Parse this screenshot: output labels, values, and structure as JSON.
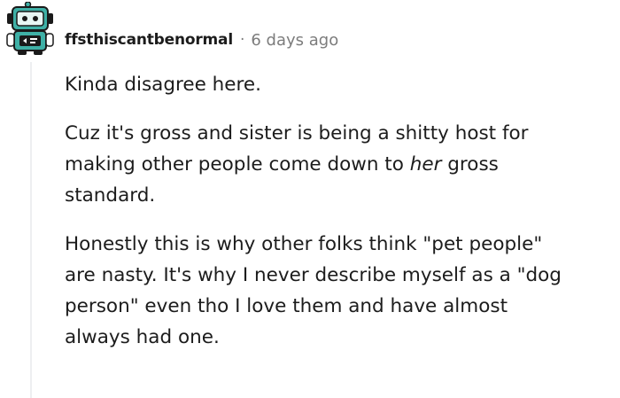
{
  "comment": {
    "author": "ffsthiscantbenormal",
    "separator": "·",
    "timestamp": "6 days ago",
    "avatar_icon": "robot-avatar-icon",
    "paragraphs": [
      {
        "lines": [
          "Kinda disagree here."
        ]
      },
      {
        "line1": "Cuz it's gross and sister is being a shitty host for",
        "line2_before": "making other people come down to ",
        "line2_emphasis": "her",
        "line2_after": " gross",
        "line3": "standard."
      },
      {
        "lines": [
          "Honestly this is why other folks think \"pet people\"",
          "are nasty. It's why I never describe myself as a \"dog",
          "person\" even tho I love them and have almost",
          "always had one."
        ]
      }
    ]
  },
  "colors": {
    "text": "#1c1c1c",
    "meta": "#7c7c7c",
    "thread_line": "#edeff1",
    "avatar_teal": "#3fb0a6",
    "avatar_dark": "#1a1a1a"
  }
}
